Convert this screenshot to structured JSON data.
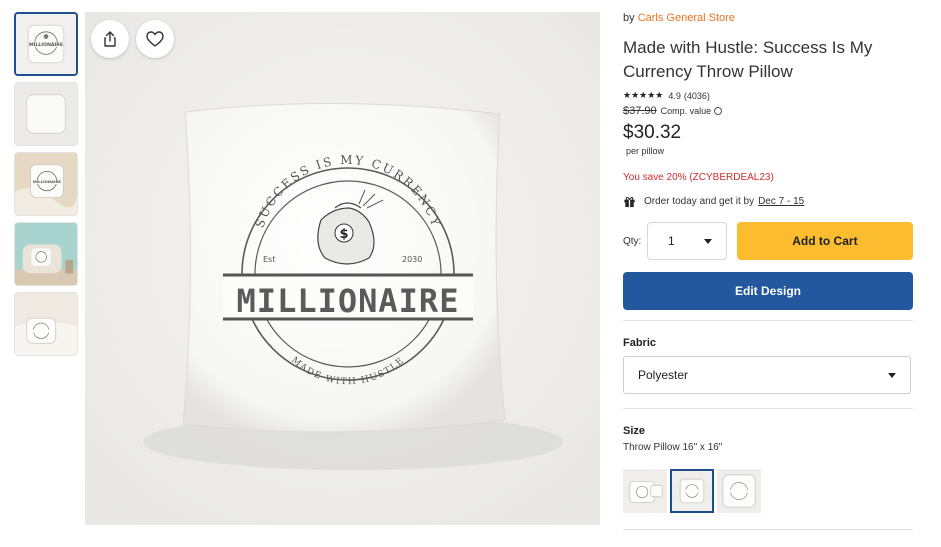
{
  "thumbnails": [
    {
      "scene": "pillow-front",
      "active": true
    },
    {
      "scene": "pillow-plain",
      "active": false
    },
    {
      "scene": "pillow-on-blanket",
      "active": false
    },
    {
      "scene": "pillow-on-chair",
      "active": false
    },
    {
      "scene": "pillow-on-bed",
      "active": false
    }
  ],
  "artwork": {
    "arc_top": "SUCCESS IS MY CURRENCY",
    "est": "Est",
    "year": "2030",
    "banner": "MILLIONAIRE",
    "arc_bottom": "MADE WITH HUSTLE",
    "money_symbol": "$"
  },
  "hero_buttons": {
    "share_icon": "share-icon",
    "favorite_icon": "heart-icon"
  },
  "product": {
    "by_prefix": "by",
    "store": "Carls General Store",
    "title": "Made with Hustle: Success Is My Currency Throw Pillow",
    "stars": "★★★★★",
    "rating": "4.9",
    "review_count": "(4036)",
    "old_price": "$37.90",
    "comp_label": "Comp. value",
    "price": "$30.32",
    "per_unit": "per pillow",
    "savings": "You save 20% (ZCYBERDEAL23)",
    "delivery_text": "Order today and get it by",
    "delivery_date": "Dec 7 - 15"
  },
  "cart": {
    "qty_label": "Qty:",
    "qty_value": "1",
    "add_label": "Add to Cart",
    "edit_label": "Edit Design"
  },
  "options": {
    "fabric_label": "Fabric",
    "fabric_value": "Polyester",
    "size_label": "Size",
    "size_value": "Throw Pillow 16\" x 16\""
  },
  "colors": {
    "accent_orange": "#e8731f",
    "add_to_cart": "#fbbc2f",
    "edit_design": "#23589e",
    "savings_red": "#d12e2e",
    "selected_border": "#1f4e8c"
  }
}
